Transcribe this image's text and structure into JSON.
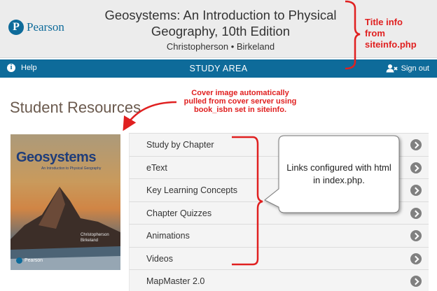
{
  "header": {
    "brand_mark": "P",
    "brand_name": "Pearson",
    "title": "Geosystems: An Introduction to Physical Geography, 10th Edition",
    "authors": "Christopherson • Birkeland"
  },
  "navbar": {
    "help_icon": "i",
    "help_label": "Help",
    "center_title": "STUDY AREA",
    "signout_label": "Sign out",
    "icons": [
      "info-icon",
      "user-remove-icon"
    ]
  },
  "resources": {
    "title": "Student Resources",
    "links": [
      {
        "label": "Study by Chapter"
      },
      {
        "label": "eText"
      },
      {
        "label": "Key Learning Concepts"
      },
      {
        "label": "Chapter Quizzes"
      },
      {
        "label": "Animations"
      },
      {
        "label": "Videos"
      },
      {
        "label": "MapMaster 2.0"
      }
    ]
  },
  "cover": {
    "title": "Geosystems",
    "subtitle": "An Introduction to Physical Geography",
    "authors_line1": "Christopherson",
    "authors_line2": "Birkeland",
    "publisher": "Pearson"
  },
  "annotations": {
    "title_info_line1": "Title info",
    "title_info_line2": "from",
    "title_info_line3": "siteinfo.php",
    "cover_line1": "Cover image automatically",
    "cover_line2": "pulled from cover server using",
    "cover_line3": "book_isbn set in siteinfo.",
    "links_callout": "Links configured with html in index.php."
  },
  "colors": {
    "brand_blue": "#0e6b9a",
    "annotation_red": "#e02020",
    "heading_brown": "#6b5a4e"
  }
}
